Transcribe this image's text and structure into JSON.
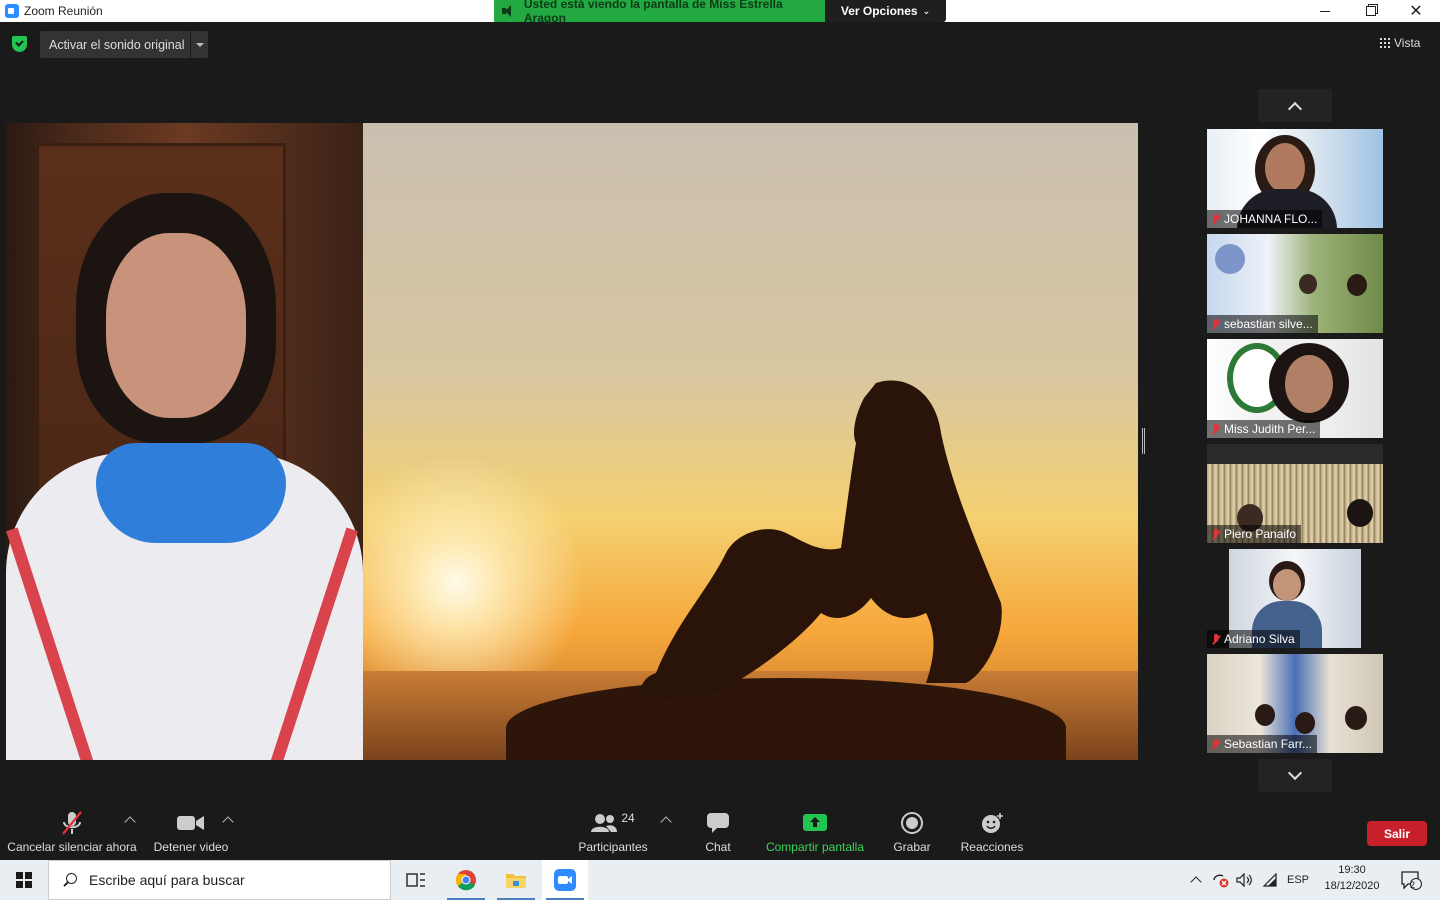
{
  "window": {
    "title": "Zoom Reunión",
    "share_banner": "Usted está viendo la pantalla de Miss Estrella Aragon",
    "view_options": "Ver Opciones",
    "minimize_icon": "minimize-icon",
    "maximize_icon": "restore-icon",
    "close_icon": "close-icon"
  },
  "topbar": {
    "original_sound": "Activar el sonido original",
    "view": "Vista"
  },
  "participants": [
    {
      "name": "JOHANNA FLO...",
      "muted": true
    },
    {
      "name": "sebastian silve...",
      "muted": true
    },
    {
      "name": "Miss Judith Per...",
      "muted": true
    },
    {
      "name": "Piero Panaifo",
      "muted": true
    },
    {
      "name": "Adriano Silva",
      "muted": true
    },
    {
      "name": "Sebastian Farr...",
      "muted": true
    }
  ],
  "toolbar": {
    "unmute": "Cancelar silenciar ahora",
    "stop_video": "Detener video",
    "participants_label": "Participantes",
    "participants_count": "24",
    "chat": "Chat",
    "share_screen": "Compartir pantalla",
    "record": "Grabar",
    "reactions": "Reacciones",
    "leave": "Salir"
  },
  "taskbar": {
    "search_placeholder": "Escribe aquí para buscar",
    "language": "ESP",
    "time": "19:30",
    "date": "18/12/2020",
    "notifications": "2"
  },
  "colors": {
    "share_green": "#23a942",
    "leave_red": "#c8202a",
    "background": "#1a1a1a"
  }
}
